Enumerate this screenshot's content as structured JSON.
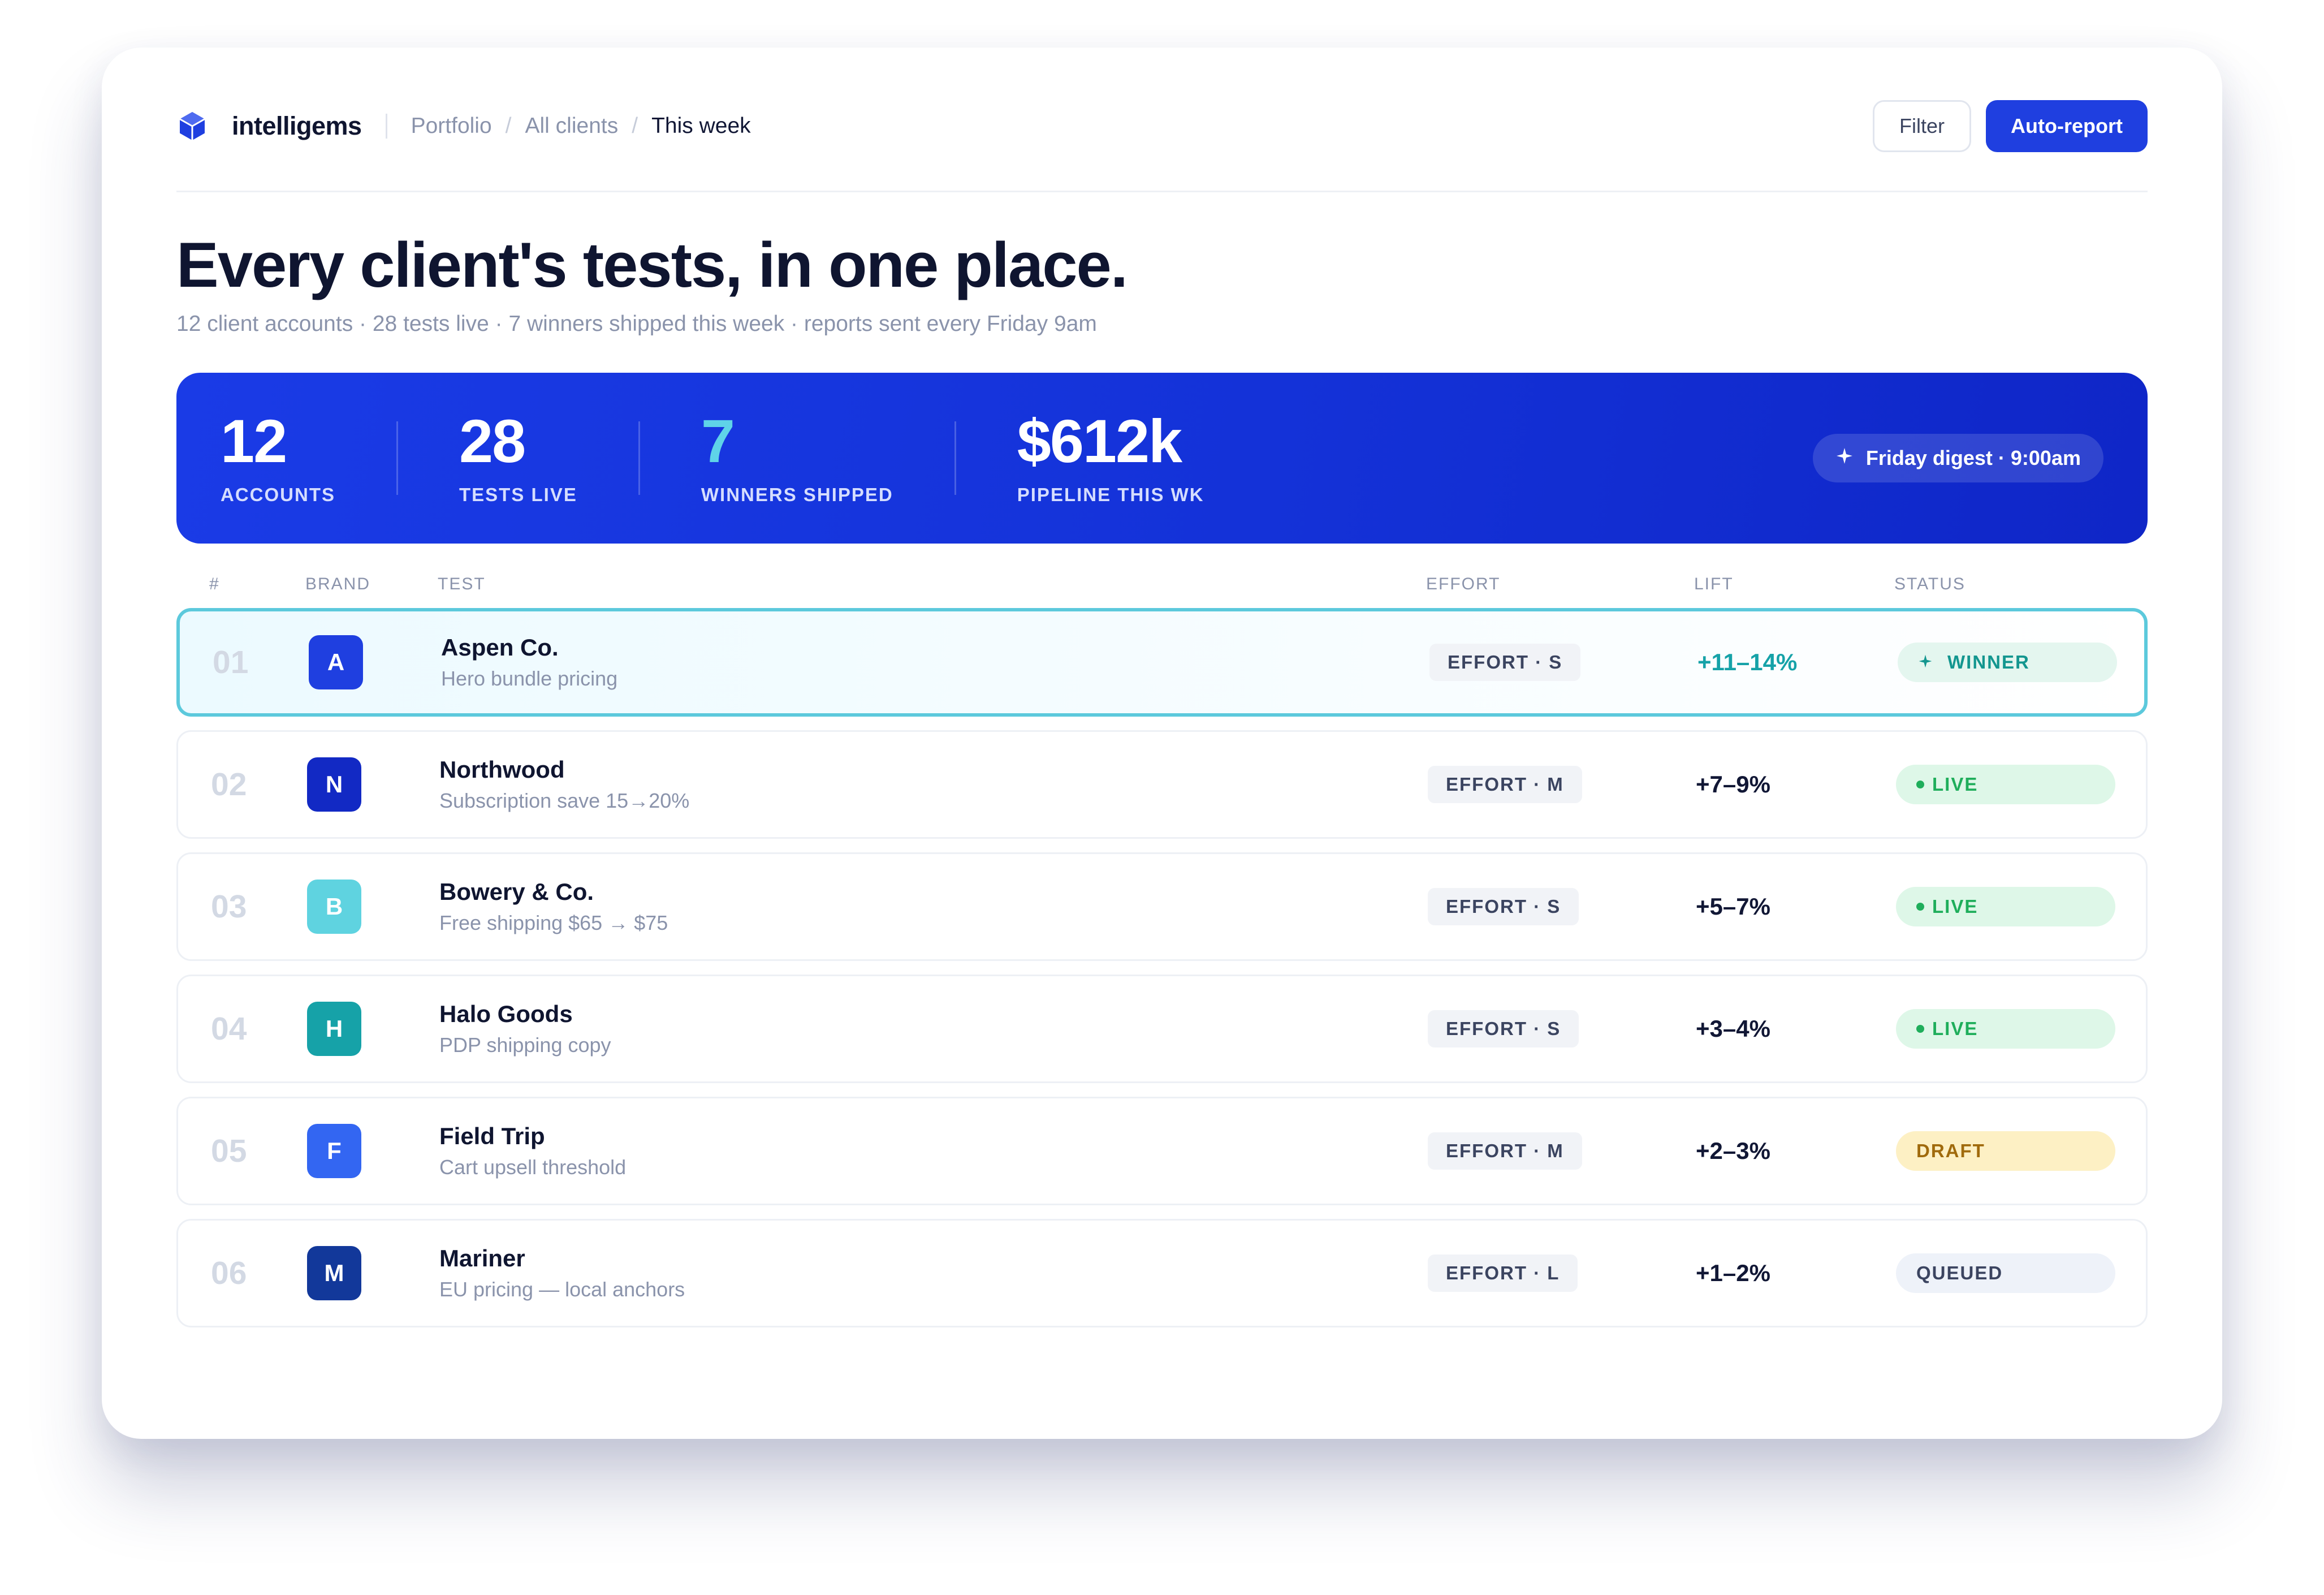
{
  "header": {
    "brand": "intelligems",
    "breadcrumbs": [
      "Portfolio",
      "All clients",
      "This week"
    ],
    "breadcrumb_sep": "/",
    "filter_label": "Filter",
    "auto_report_label": "Auto-report"
  },
  "main": {
    "title": "Every client's tests, in one place.",
    "subtitle": "12 client accounts · 28 tests live · 7 winners shipped this week · reports sent every Friday 9am"
  },
  "stats": {
    "items": [
      {
        "value": "12",
        "label": "ACCOUNTS"
      },
      {
        "value": "28",
        "label": "TESTS LIVE"
      },
      {
        "value": "7",
        "label": "WINNERS SHIPPED"
      },
      {
        "value": "$612k",
        "label": "PIPELINE THIS WK"
      }
    ],
    "digest_label": "Friday digest · 9:00am",
    "accent_color": "#5fd3e8"
  },
  "table": {
    "headers": {
      "num": "#",
      "brand": "BRAND",
      "test": "TEST",
      "effort": "EFFORT",
      "lift": "LIFT",
      "status": "STATUS"
    },
    "rows": [
      {
        "num": "01",
        "initial": "A",
        "avatar_color": "#1f3fe0",
        "brand": "Aspen Co.",
        "test": "Hero bundle pricing",
        "effort": "EFFORT · S",
        "lift": "+11–14%",
        "status": "WINNER",
        "status_type": "winner"
      },
      {
        "num": "02",
        "initial": "N",
        "avatar_color": "#1229c4",
        "brand": "Northwood",
        "test": "Subscription save 15→20%",
        "effort": "EFFORT · M",
        "lift": "+7–9%",
        "status": "LIVE",
        "status_type": "live"
      },
      {
        "num": "03",
        "initial": "B",
        "avatar_color": "#5fd3e0",
        "brand": "Bowery & Co.",
        "test": "Free shipping $65 → $75",
        "effort": "EFFORT · S",
        "lift": "+5–7%",
        "status": "LIVE",
        "status_type": "live"
      },
      {
        "num": "04",
        "initial": "H",
        "avatar_color": "#16a2a8",
        "brand": "Halo Goods",
        "test": "PDP shipping copy",
        "effort": "EFFORT · S",
        "lift": "+3–4%",
        "status": "LIVE",
        "status_type": "live"
      },
      {
        "num": "05",
        "initial": "F",
        "avatar_color": "#3366f2",
        "brand": "Field Trip",
        "test": "Cart upsell threshold",
        "effort": "EFFORT · M",
        "lift": "+2–3%",
        "status": "DRAFT",
        "status_type": "draft"
      },
      {
        "num": "06",
        "initial": "M",
        "avatar_color": "#12389a",
        "brand": "Mariner",
        "test": "EU pricing — local anchors",
        "effort": "EFFORT · L",
        "lift": "+1–2%",
        "status": "QUEUED",
        "status_type": "queued"
      }
    ]
  },
  "colors": {
    "primary": "#1f3fe0",
    "highlight_border": "#5cc9dc"
  }
}
